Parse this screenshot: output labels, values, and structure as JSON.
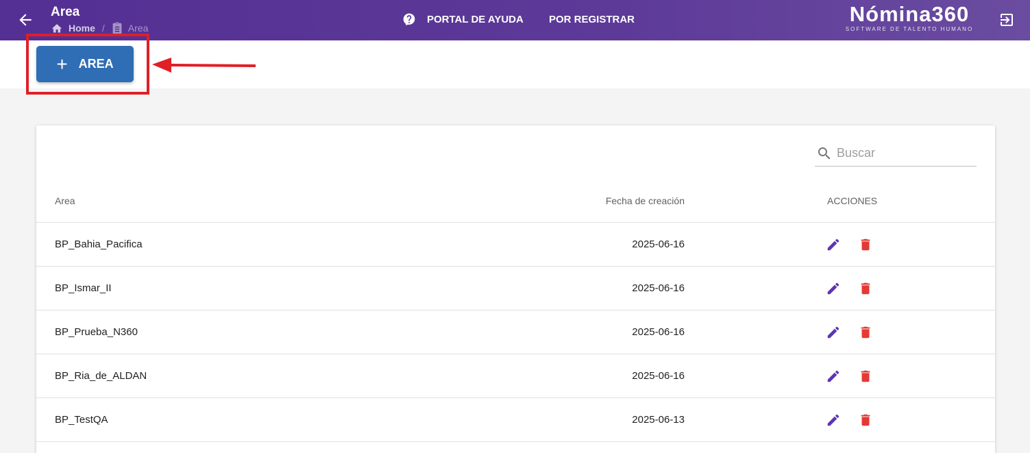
{
  "header": {
    "title": "Area",
    "breadcrumb": {
      "home": "Home",
      "current": "Area"
    },
    "nav": {
      "help": "PORTAL DE AYUDA",
      "register": "POR REGISTRAR"
    },
    "logo": {
      "main": "Nómina360",
      "sub": "SOFTWARE DE TALENTO HUMANO"
    }
  },
  "toolbar": {
    "add_plus": "+",
    "add_label": "AREA"
  },
  "search": {
    "placeholder": "Buscar",
    "value": ""
  },
  "table": {
    "columns": {
      "area": "Area",
      "fecha": "Fecha de creación",
      "acciones": "ACCIONES"
    },
    "rows": [
      {
        "area": "BP_Bahia_Pacifica",
        "fecha": "2025-06-16"
      },
      {
        "area": "BP_Ismar_II",
        "fecha": "2025-06-16"
      },
      {
        "area": "BP_Prueba_N360",
        "fecha": "2025-06-16"
      },
      {
        "area": "BP_Ria_de_ALDAN",
        "fecha": "2025-06-16"
      },
      {
        "area": "BP_TestQA",
        "fecha": "2025-06-13"
      }
    ]
  },
  "colors": {
    "header_bg": "#542f94",
    "primary_button": "#2f6db5",
    "edit_icon": "#5e35b1",
    "delete_icon": "#e53935",
    "annotation": "#e01f26"
  },
  "icons": {
    "back": "arrow-left-icon",
    "home": "home-icon",
    "clipboard": "clipboard-icon",
    "help": "help-circle-icon",
    "logout": "logout-icon",
    "search": "search-icon",
    "edit": "pencil-icon",
    "delete": "trash-icon"
  }
}
